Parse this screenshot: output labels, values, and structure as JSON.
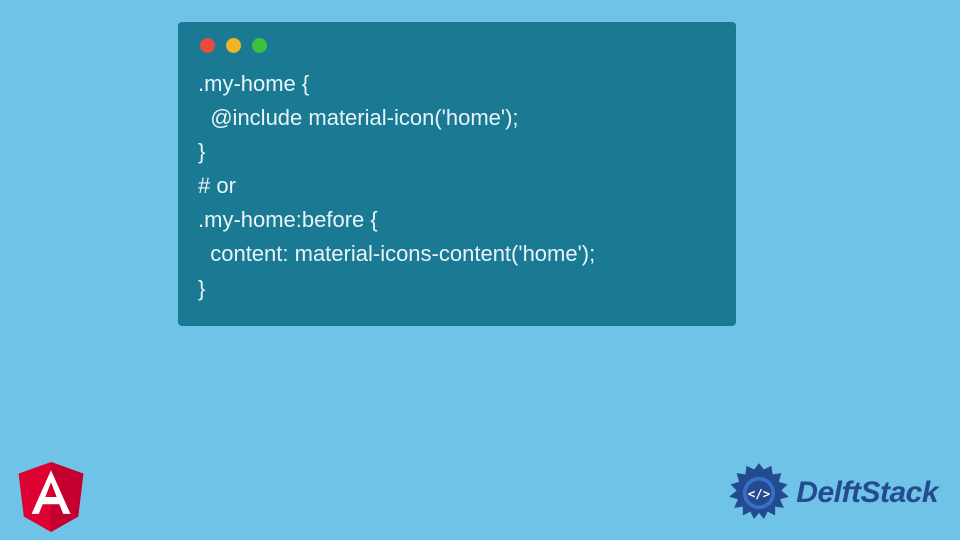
{
  "code": {
    "line1": ".my-home {",
    "line2": "  @include material-icon('home');",
    "line3": "}",
    "line4": "# or",
    "line5": ".my-home:before {",
    "line6": "  content: material-icons-content('home');",
    "line7": "}"
  },
  "brand": {
    "name": "DelftStack"
  }
}
